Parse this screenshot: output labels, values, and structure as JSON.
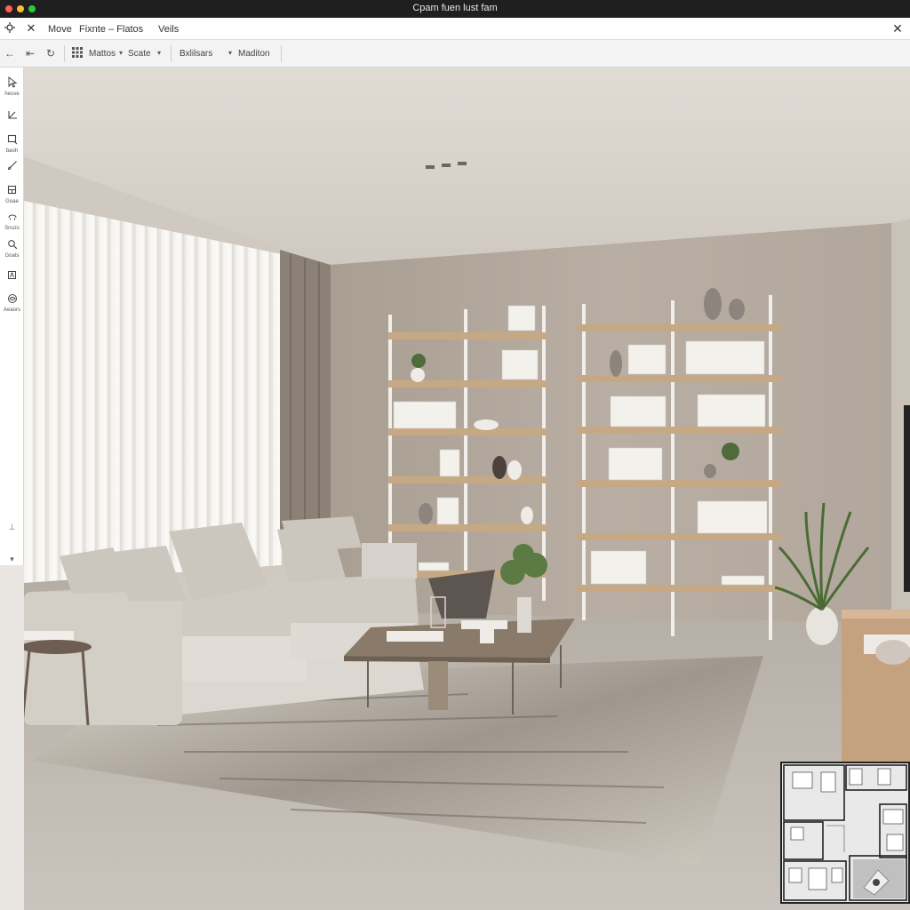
{
  "window": {
    "title": "Cpam fuen lust fam"
  },
  "menubar": {
    "items": [
      "Move",
      "Fixnte – Flatos",
      "Veils"
    ]
  },
  "toolbar": {
    "mode_label": "Mattos",
    "scale_label": "Scate",
    "view_label": "Bxlilsars",
    "material_label": "Maditon"
  },
  "tools": [
    {
      "icon": "select-arrow-icon",
      "label": "heuve"
    },
    {
      "icon": "draw-corner-icon",
      "label": ""
    },
    {
      "icon": "rectangle-icon",
      "label": "baoh"
    },
    {
      "icon": "paint-brush-icon",
      "label": ""
    },
    {
      "icon": "furniture-icon",
      "label": "Goae"
    },
    {
      "icon": "smile-icon",
      "label": "Snuzs"
    },
    {
      "icon": "search-icon",
      "label": "Goats"
    },
    {
      "icon": "text-tool-icon",
      "label": ""
    },
    {
      "icon": "visibility-icon",
      "label": "Aeaors"
    }
  ],
  "colors": {
    "wall": "#b5ab9f",
    "ceiling": "#dad5ce",
    "floor": "#bdb6ad",
    "shelf_wood": "#c7a884",
    "sofa": "#dcd8d1"
  }
}
